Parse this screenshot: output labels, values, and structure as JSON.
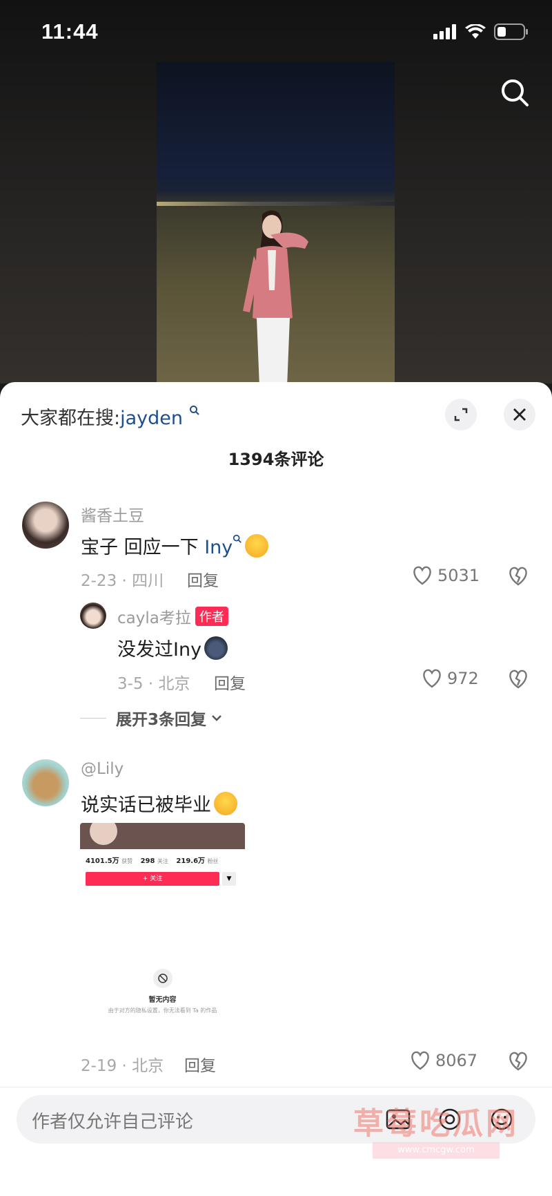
{
  "status": {
    "time": "11:44"
  },
  "sheet": {
    "hot_search_prefix": "大家都在搜:",
    "hot_search_keyword": "jayden",
    "comment_count": "1394条评论"
  },
  "comments": [
    {
      "user": "酱香土豆",
      "text": "宝子 回应一下",
      "keyword": "Iny",
      "date_loc": "2-23 · 四川",
      "reply": "回复",
      "likes": "5031"
    },
    {
      "user": "@Lily",
      "text": "说实话已被毕业",
      "date_loc": "2-19 · 北京",
      "reply": "回复",
      "likes": "8067",
      "screenshot": {
        "s1": "4101.5万",
        "s1_label": "获赞",
        "s2": "298",
        "s2_label": "关注",
        "s3": "219.6万",
        "s3_label": "粉丝",
        "follow": "+ 关注",
        "empty": "暂无内容",
        "empty_sub": "由于对方的隐私设置，你无法看到 Ta 的作品"
      }
    }
  ],
  "sub_reply": {
    "user": "cayla考拉",
    "tag": "作者",
    "text": "没发过Iny",
    "date_loc": "3-5 · 北京",
    "reply": "回复",
    "likes": "972",
    "expand": "展开3条回复"
  },
  "input": {
    "placeholder": "作者仅允许自己评论"
  },
  "watermark": {
    "text": "草莓吃瓜网",
    "url": "www.cmcgw.com"
  }
}
